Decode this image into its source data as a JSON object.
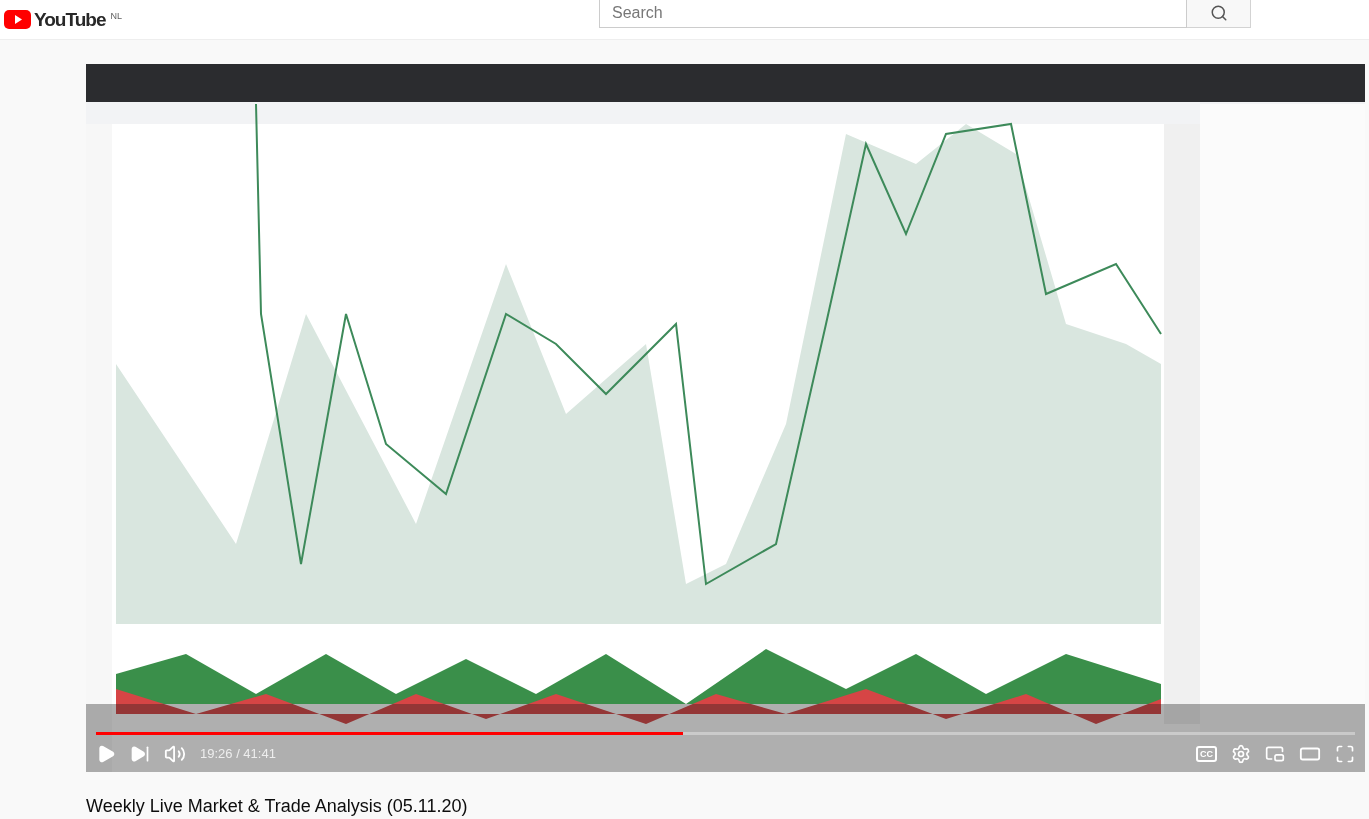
{
  "header": {
    "logo": "YouTube",
    "region": "NL",
    "search": {
      "placeholder": "Search"
    }
  },
  "player": {
    "progress": {
      "level": 0.466
    },
    "time": "19:26 / 41:41",
    "captions": "CC"
  },
  "video_title": "Weekly Live Market & Trade Analysis (05.11.20)"
}
